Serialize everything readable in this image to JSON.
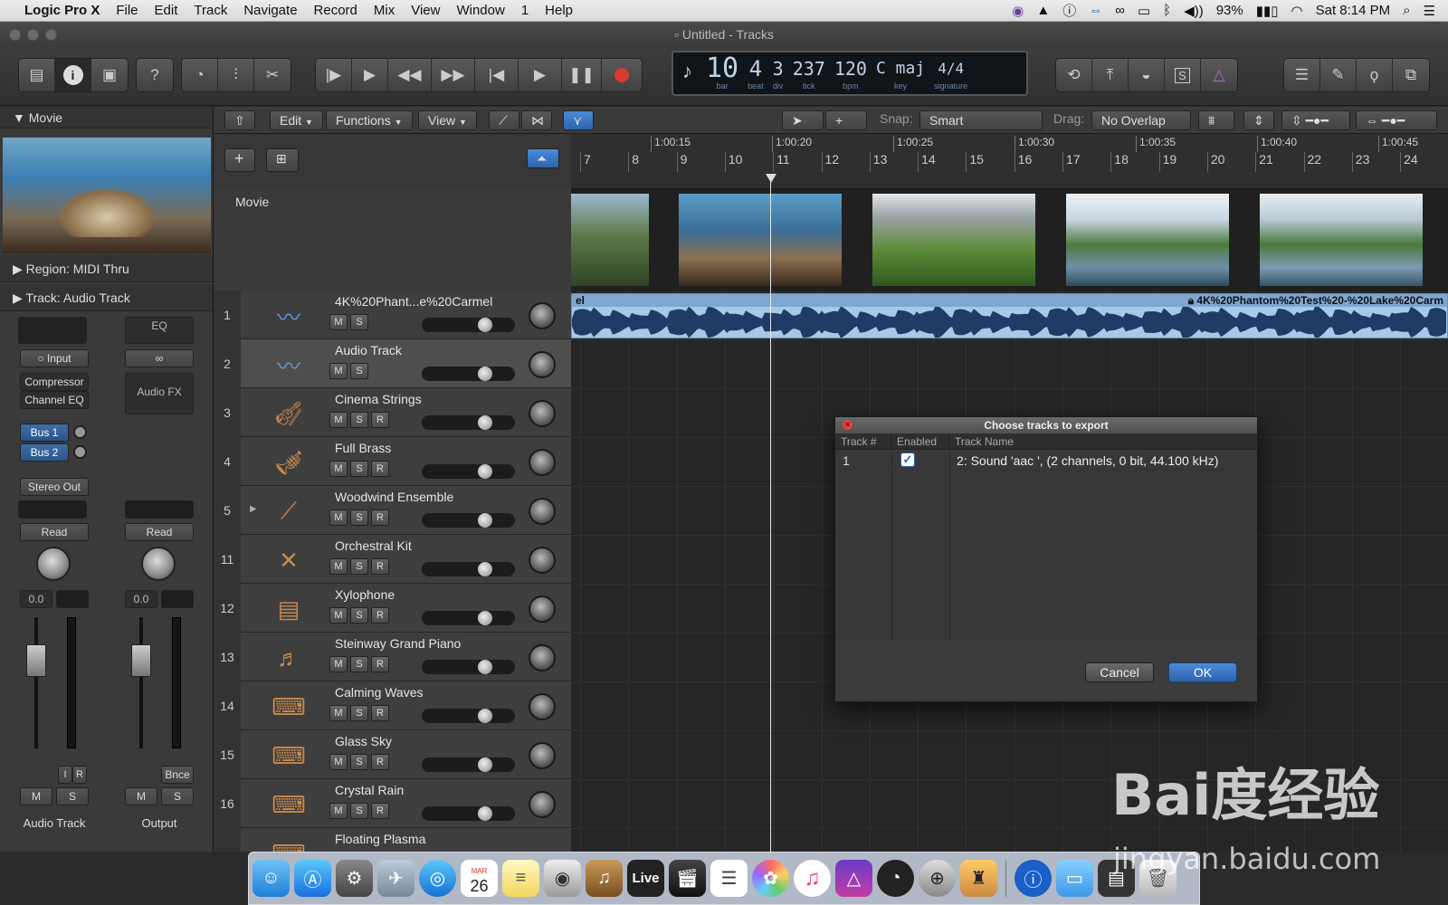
{
  "menubar": {
    "apple": "",
    "items": [
      "Logic Pro X",
      "File",
      "Edit",
      "Track",
      "Navigate",
      "Record",
      "Mix",
      "View",
      "Window",
      "1",
      "Help"
    ],
    "battery": "93%",
    "clock": "Sat 8:14 PM"
  },
  "window": {
    "title": "Untitled - Tracks"
  },
  "lcd": {
    "bar": "10",
    "bar_l": "bar",
    "beat": "4",
    "beat_l": "beat",
    "div": "3",
    "div_l": "div",
    "tick": "237",
    "tick_l": "tick",
    "bpm": "120",
    "bpm_l": "bpm",
    "key": "C maj",
    "key_l": "key",
    "sig": "4/4",
    "sig_l": "signature"
  },
  "inspector": {
    "movie_label": "Movie",
    "region_label": "Region: MIDI Thru",
    "track_label": "Track:  Audio Track",
    "strip1": {
      "input": "Input",
      "fx1": "Compressor",
      "fx2": "Channel EQ",
      "bus1": "Bus 1",
      "bus2": "Bus 2",
      "out": "Stereo Out",
      "auto": "Read",
      "vol": "0.0",
      "m": "M",
      "s": "S",
      "i": "I",
      "r": "R",
      "name": "Audio Track"
    },
    "strip2": {
      "eq": "EQ",
      "fx": "Audio FX",
      "auto": "Read",
      "vol": "0.0",
      "m": "M",
      "s": "S",
      "bnce": "Bnce",
      "name": "Output"
    }
  },
  "editbar": {
    "edit": "Edit",
    "functions": "Functions",
    "view": "View",
    "snap_label": "Snap:",
    "snap_value": "Smart",
    "drag_label": "Drag:",
    "drag_value": "No Overlap"
  },
  "ruler": {
    "times": [
      "1:00:15",
      "1:00:20",
      "1:00:25",
      "1:00:30",
      "1:00:35",
      "1:00:40",
      "1:00:45"
    ],
    "bars": [
      "7",
      "8",
      "9",
      "10",
      "11",
      "12",
      "13",
      "14",
      "15",
      "16",
      "17",
      "18",
      "19",
      "20",
      "21",
      "22",
      "23",
      "24"
    ]
  },
  "movie_track": {
    "label": "Movie"
  },
  "region": {
    "left": "el",
    "right": "4K%20Phantom%20Test%20-%20Lake%20Carm"
  },
  "tracks": [
    {
      "num": "1",
      "name": "4K%20Phant...e%20Carmel",
      "icon": "waveform-icon",
      "btns": [
        "M",
        "S"
      ]
    },
    {
      "num": "2",
      "name": "Audio Track",
      "icon": "waveform-icon",
      "btns": [
        "M",
        "S"
      ]
    },
    {
      "num": "3",
      "name": "Cinema Strings",
      "icon": "violin-icon",
      "btns": [
        "M",
        "S",
        "R"
      ]
    },
    {
      "num": "4",
      "name": "Full Brass",
      "icon": "trumpet-icon",
      "btns": [
        "M",
        "S",
        "R"
      ]
    },
    {
      "num": "5",
      "name": "Woodwind Ensemble",
      "icon": "flute-icon",
      "btns": [
        "M",
        "S",
        "R"
      ]
    },
    {
      "num": "11",
      "name": "Orchestral Kit",
      "icon": "drumsticks-icon",
      "btns": [
        "M",
        "S",
        "R"
      ]
    },
    {
      "num": "12",
      "name": "Xylophone",
      "icon": "xylophone-icon",
      "btns": [
        "M",
        "S",
        "R"
      ]
    },
    {
      "num": "13",
      "name": "Steinway Grand Piano",
      "icon": "piano-icon",
      "btns": [
        "M",
        "S",
        "R"
      ]
    },
    {
      "num": "14",
      "name": "Calming Waves",
      "icon": "keyboard-icon",
      "btns": [
        "M",
        "S",
        "R"
      ]
    },
    {
      "num": "15",
      "name": "Glass Sky",
      "icon": "keyboard-icon",
      "btns": [
        "M",
        "S",
        "R"
      ]
    },
    {
      "num": "16",
      "name": "Crystal Rain",
      "icon": "keyboard-icon",
      "btns": [
        "M",
        "S",
        "R"
      ]
    },
    {
      "num": "",
      "name": "Floating Plasma",
      "icon": "keyboard-icon",
      "btns": []
    }
  ],
  "dialog": {
    "title": "Choose tracks to export",
    "col_track": "Track #",
    "col_enabled": "Enabled",
    "col_name": "Track Name",
    "row1_num": "1",
    "row1_checked": "✓",
    "row1_name": "2: Sound 'aac ', (2 channels, 0 bit, 44.100 kHz)",
    "cancel": "Cancel",
    "ok": "OK"
  },
  "dock": {
    "live": "Live",
    "calendar_day": "26",
    "calendar_month": "MAR"
  },
  "watermark": {
    "main": "Bai度经验",
    "sub": "jingyan.baidu.com"
  },
  "colors": {
    "accent": "#3d7bd0",
    "region": "#a8c8e8",
    "record": "#d83a2e"
  }
}
